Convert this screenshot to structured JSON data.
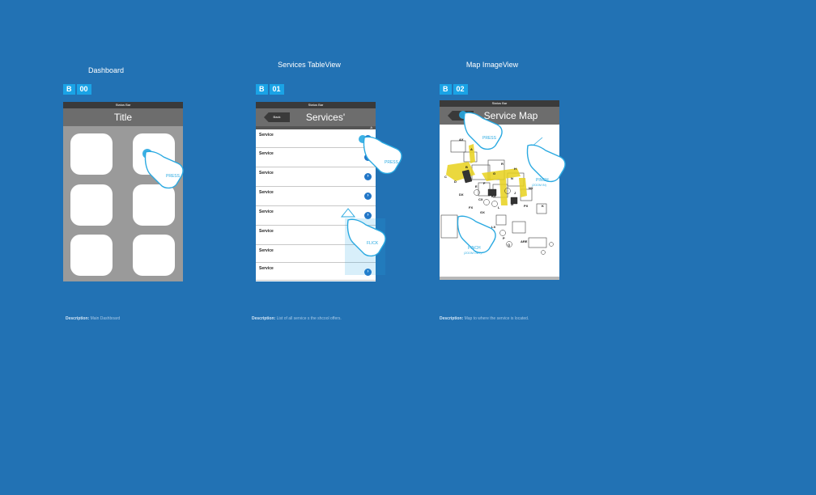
{
  "screens": [
    {
      "title": "Dashboard",
      "badge": {
        "letter": "B",
        "number": "00"
      },
      "status_bar": "Status Bar",
      "nav_title": "Title",
      "gesture_label": "PRESS",
      "description_label": "Description:",
      "description_text": "Main Dashboard"
    },
    {
      "title": "Services TableView",
      "badge": {
        "letter": "B",
        "number": "01"
      },
      "status_bar": "Status Bar",
      "nav_title": "Services'",
      "back_label": "Back",
      "rows": [
        "Service",
        "Service",
        "Service",
        "Service",
        "Service",
        "Service",
        "Service",
        "Service"
      ],
      "index_mark": "A",
      "gesture_press": "PRESS",
      "gesture_flick": "FLICK",
      "description_label": "Description:",
      "description_text": "List of all service s the shcool offers."
    },
    {
      "title": "Map ImageView",
      "badge": {
        "letter": "B",
        "number": "02"
      },
      "status_bar": "Status Bar",
      "nav_title": "Service Map",
      "gesture_press": "PRESS",
      "gesture_pinch_in": "PINCH",
      "gesture_pinch_in_sub": "(ZOOM IN)",
      "gesture_pinch_out": "PINCH",
      "gesture_pinch_out_sub": "(ZOOM OUT)",
      "map_labels": [
        "AX",
        "A",
        "B",
        "C",
        "D",
        "E",
        "F",
        "G",
        "H",
        "K",
        "R",
        "N",
        "P",
        "Q",
        "J",
        "L",
        "M",
        "DX",
        "CX",
        "FX",
        "GX",
        "KX",
        "LX",
        "PX",
        "NX",
        "ARE"
      ],
      "description_label": "Description:",
      "description_text": "Map to where the service is located."
    }
  ],
  "colors": {
    "background": "#2272b4",
    "badge": "#1aa3e6",
    "gesture": "#29a9e1",
    "disclosure": "#2277c8"
  }
}
